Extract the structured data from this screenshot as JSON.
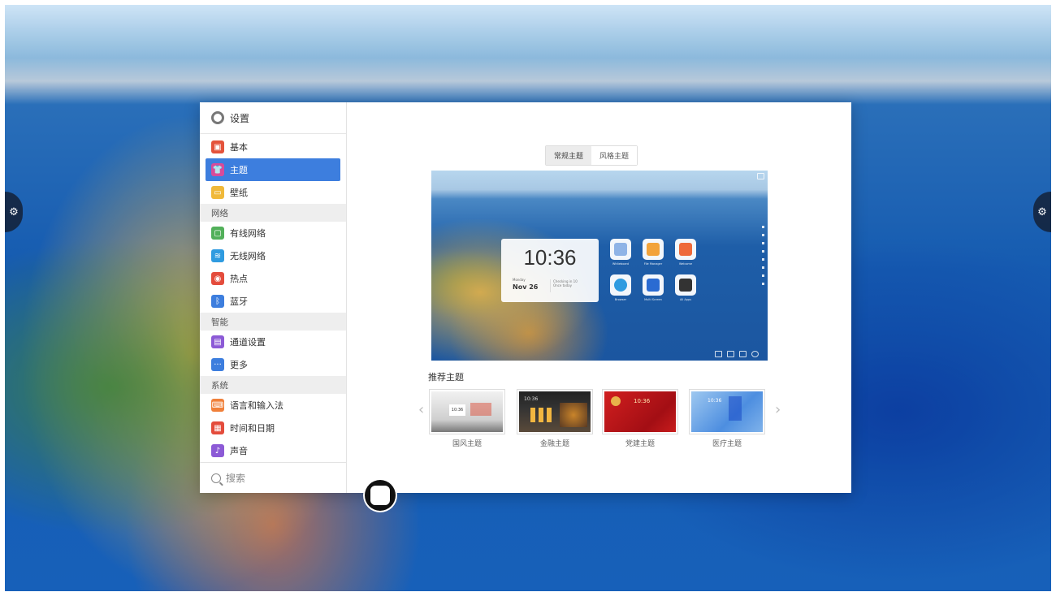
{
  "window": {
    "title": "设置"
  },
  "sidebar": {
    "items": [
      {
        "label": "基本",
        "icon": "basic-icon",
        "color": "#e4533b"
      },
      {
        "label": "主题",
        "icon": "theme-shirt-icon",
        "color": "#d84b9a",
        "active": true
      },
      {
        "label": "壁纸",
        "icon": "wallpaper-icon",
        "color": "#f0b93a"
      }
    ],
    "groups": [
      {
        "title": "网络",
        "items": [
          {
            "label": "有线网络",
            "icon": "wired-network-icon",
            "color": "#52b05a"
          },
          {
            "label": "无线网络",
            "icon": "wifi-icon",
            "color": "#2f9be0"
          },
          {
            "label": "热点",
            "icon": "hotspot-icon",
            "color": "#e44c3c"
          },
          {
            "label": "蓝牙",
            "icon": "bluetooth-icon",
            "color": "#3d7ede"
          }
        ]
      },
      {
        "title": "智能",
        "items": [
          {
            "label": "通道设置",
            "icon": "channel-icon",
            "color": "#8c5ad6"
          },
          {
            "label": "更多",
            "icon": "more-icon",
            "color": "#3d7ede"
          }
        ]
      },
      {
        "title": "系统",
        "items": [
          {
            "label": "语言和输入法",
            "icon": "language-icon",
            "color": "#f0803a"
          },
          {
            "label": "时间和日期",
            "icon": "datetime-icon",
            "color": "#e44c3c"
          },
          {
            "label": "声音",
            "icon": "sound-icon",
            "color": "#8c5ad6"
          }
        ]
      }
    ],
    "search_placeholder": "搜索"
  },
  "main": {
    "tabs": [
      {
        "label": "常规主题",
        "active": true
      },
      {
        "label": "风格主题",
        "active": false
      }
    ],
    "preview": {
      "time": "10:36",
      "weekday": "Monday",
      "date": "Nov 26",
      "note_line1": "Checking in 10",
      "note_line2": "Once today",
      "apps": [
        {
          "label": "Whiteboard",
          "icon": "whiteboard-app-icon"
        },
        {
          "label": "File Manager",
          "icon": "file-manager-app-icon"
        },
        {
          "label": "Welcome",
          "icon": "welcome-app-icon"
        },
        {
          "label": "Browser",
          "icon": "browser-app-icon"
        },
        {
          "label": "Multi Screen",
          "icon": "multi-screen-app-icon"
        },
        {
          "label": "All Apps",
          "icon": "all-apps-icon"
        }
      ]
    },
    "recommended_title": "推荐主题",
    "themes": [
      {
        "label": "国风主题"
      },
      {
        "label": "金融主题"
      },
      {
        "label": "党建主题"
      },
      {
        "label": "医疗主题"
      }
    ],
    "theme_time": "10:36"
  }
}
